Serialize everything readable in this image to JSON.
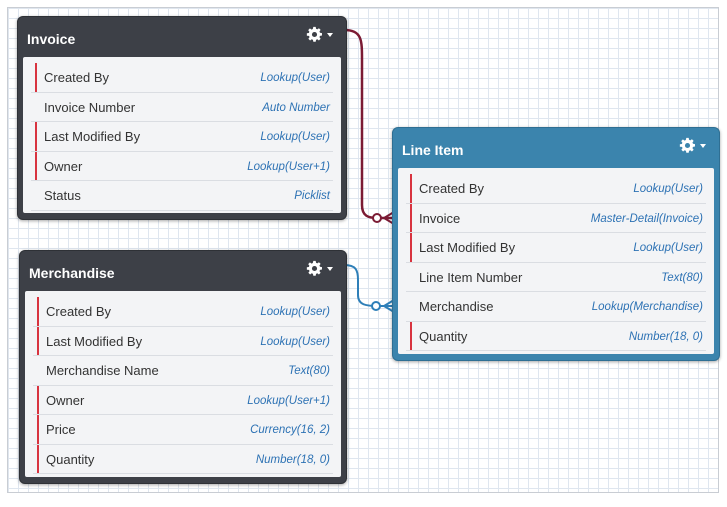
{
  "colors": {
    "dark_header": "#3d4047",
    "blue_header": "#3b84ad",
    "master_detail_line": "#7b1b34",
    "lookup_line": "#2e7fb8",
    "required_marker": "#d8333f",
    "field_type_text": "#2d72b4"
  },
  "objects": {
    "invoice": {
      "title": "Invoice",
      "fields": [
        {
          "name": "Created By",
          "type": "Lookup(User)",
          "required": true
        },
        {
          "name": "Invoice Number",
          "type": "Auto Number",
          "required": false
        },
        {
          "name": "Last Modified By",
          "type": "Lookup(User)",
          "required": true
        },
        {
          "name": "Owner",
          "type": "Lookup(User+1)",
          "required": true
        },
        {
          "name": "Status",
          "type": "Picklist",
          "required": false
        }
      ]
    },
    "merchandise": {
      "title": "Merchandise",
      "fields": [
        {
          "name": "Created By",
          "type": "Lookup(User)",
          "required": true
        },
        {
          "name": "Last Modified By",
          "type": "Lookup(User)",
          "required": true
        },
        {
          "name": "Merchandise Name",
          "type": "Text(80)",
          "required": false
        },
        {
          "name": "Owner",
          "type": "Lookup(User+1)",
          "required": true
        },
        {
          "name": "Price",
          "type": "Currency(16, 2)",
          "required": true
        },
        {
          "name": "Quantity",
          "type": "Number(18, 0)",
          "required": true
        }
      ]
    },
    "line_item": {
      "title": "Line Item",
      "fields": [
        {
          "name": "Created By",
          "type": "Lookup(User)",
          "required": true
        },
        {
          "name": "Invoice",
          "type": "Master-Detail(Invoice)",
          "required": true
        },
        {
          "name": "Last Modified By",
          "type": "Lookup(User)",
          "required": true
        },
        {
          "name": "Line Item Number",
          "type": "Text(80)",
          "required": false
        },
        {
          "name": "Merchandise",
          "type": "Lookup(Merchandise)",
          "required": false
        },
        {
          "name": "Quantity",
          "type": "Number(18, 0)",
          "required": true
        }
      ]
    }
  },
  "icons": {
    "gear": "gear-icon",
    "caret": "caret-down-icon"
  }
}
